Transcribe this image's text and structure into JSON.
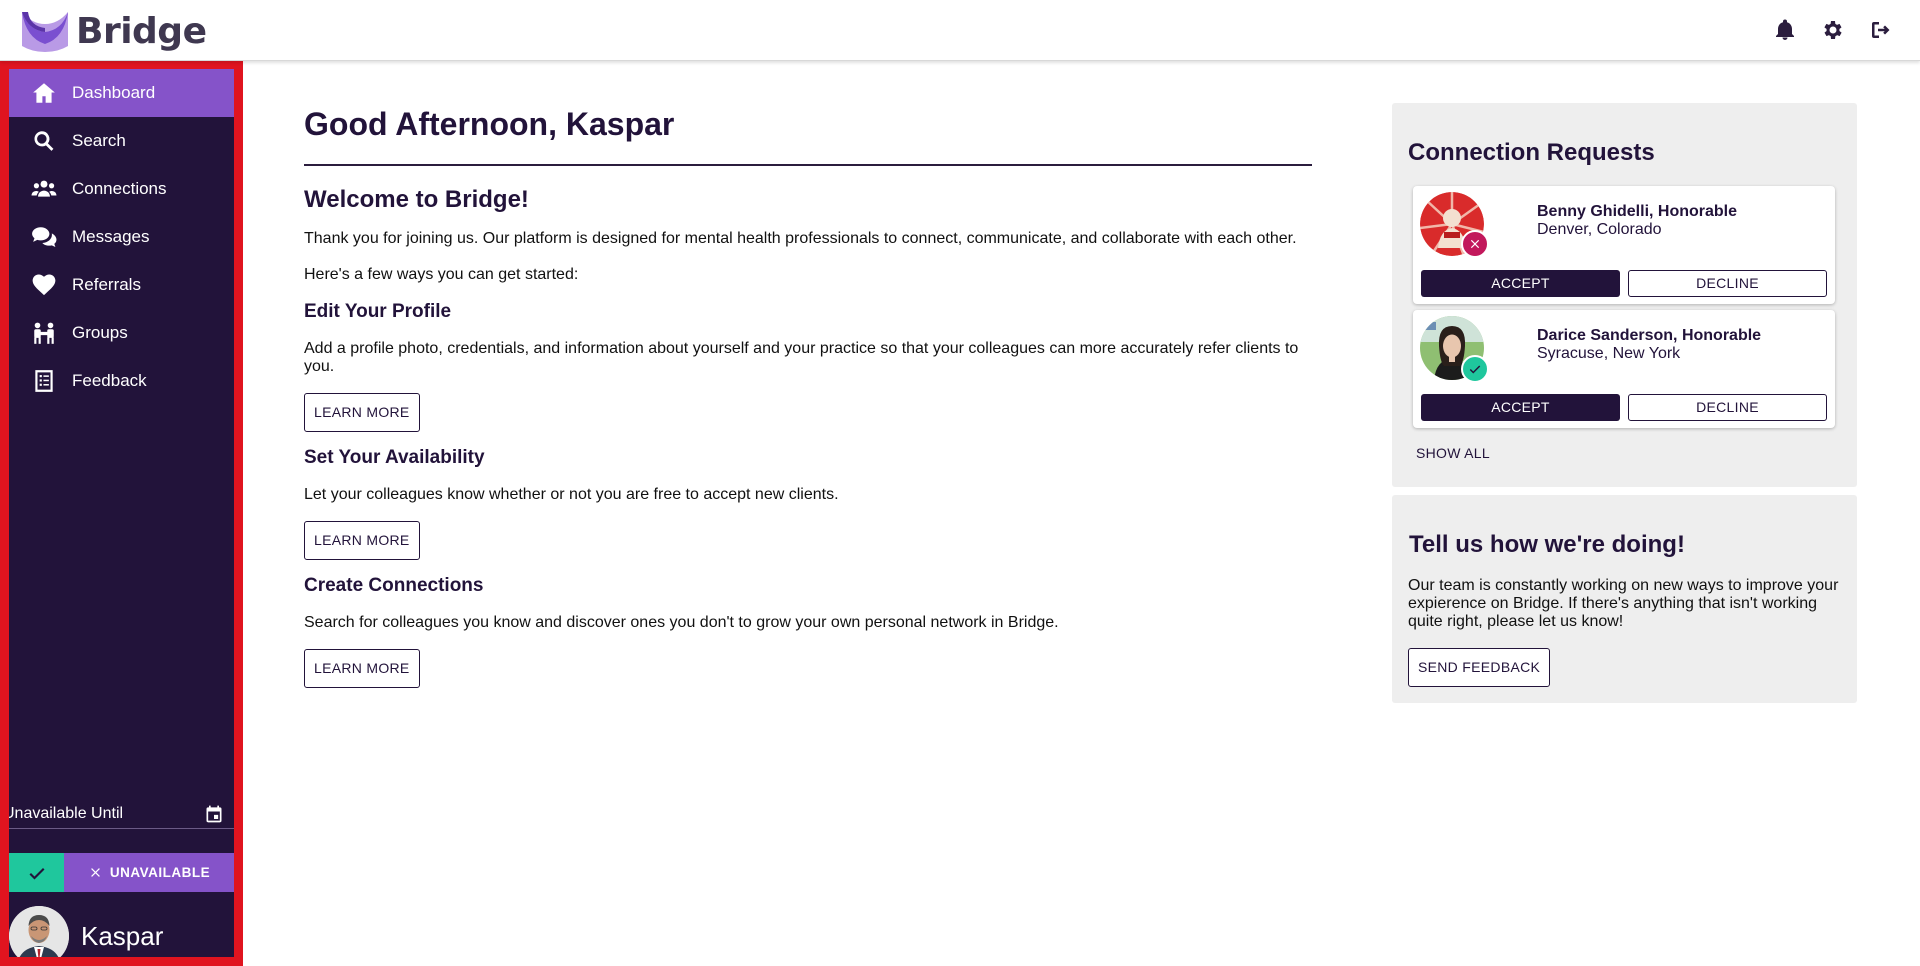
{
  "app": {
    "name": "Bridge"
  },
  "topbar": {
    "icons": [
      "bell-icon",
      "gear-icon",
      "logout-icon"
    ]
  },
  "sidebar": {
    "items": [
      {
        "label": "Dashboard",
        "icon": "home-icon",
        "active": true
      },
      {
        "label": "Search",
        "icon": "search-icon"
      },
      {
        "label": "Connections",
        "icon": "users-icon"
      },
      {
        "label": "Messages",
        "icon": "chat-icon"
      },
      {
        "label": "Referrals",
        "icon": "heart-icon"
      },
      {
        "label": "Groups",
        "icon": "group-icon"
      },
      {
        "label": "Feedback",
        "icon": "clipboard-icon"
      }
    ],
    "unavailable_until_label": "Unavailable Until",
    "status": {
      "unavailable_label": "UNAVAILABLE"
    },
    "user_name": "Kaspar"
  },
  "main": {
    "greeting": "Good Afternoon, Kaspar",
    "welcome_title": "Welcome to Bridge!",
    "intro": "Thank you for joining us. Our platform is designed for mental health professionals to connect, communicate, and collaborate with each other.",
    "ways": "Here's a few ways you can get started:",
    "sections": [
      {
        "title": "Edit Your Profile",
        "text": "Add a profile photo, credentials, and information about yourself and your practice so that your colleagues can more accurately refer clients to you.",
        "button": "LEARN MORE"
      },
      {
        "title": "Set Your Availability",
        "text": "Let your colleagues know whether or not you are free to accept new clients.",
        "button": "LEARN MORE"
      },
      {
        "title": "Create Connections",
        "text": "Search for colleagues you know and discover ones you don't to grow your own personal network in Bridge.",
        "button": "LEARN MORE"
      }
    ]
  },
  "requests": {
    "title": "Connection Requests",
    "items": [
      {
        "name": "Benny Ghidelli, Honorable",
        "location": "Denver, Colorado",
        "status": "unavailable",
        "accept": "ACCEPT",
        "decline": "DECLINE"
      },
      {
        "name": "Darice Sanderson, Honorable",
        "location": "Syracuse, New York",
        "status": "available",
        "accept": "ACCEPT",
        "decline": "DECLINE"
      }
    ],
    "show_all": "SHOW ALL"
  },
  "feedback": {
    "title": "Tell us how we're doing!",
    "text": "Our team is constantly working on new ways to improve your expierence on Bridge. If there's anything that isn't working quite right, please let us know!",
    "button": "SEND FEEDBACK"
  },
  "colors": {
    "sidebar_bg": "#22133a",
    "accent_purple": "#8553c9",
    "available_green": "#1fc79d",
    "unavailable_pink": "#c2185b",
    "highlight_border": "#e0141f"
  }
}
